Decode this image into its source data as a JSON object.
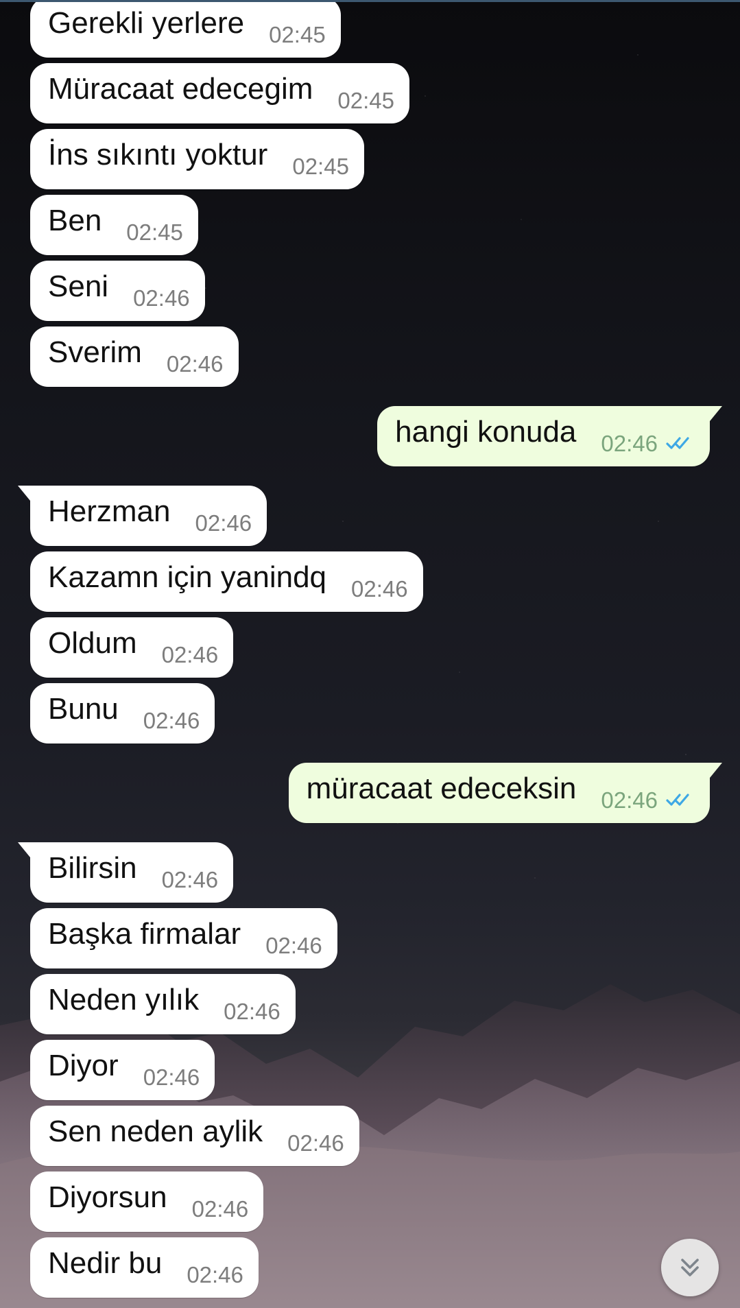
{
  "messages": [
    {
      "text": "Gerekli yerlere",
      "time": "02:45",
      "side": "incoming"
    },
    {
      "text": "Müracaat edecegim",
      "time": "02:45",
      "side": "incoming"
    },
    {
      "text": "İns sıkıntı yoktur",
      "time": "02:45",
      "side": "incoming"
    },
    {
      "text": "Ben",
      "time": "02:45",
      "side": "incoming"
    },
    {
      "text": "Seni",
      "time": "02:46",
      "side": "incoming"
    },
    {
      "text": "Sverim",
      "time": "02:46",
      "side": "incoming"
    },
    {
      "text": "hangi konuda",
      "time": "02:46",
      "side": "outgoing"
    },
    {
      "text": "Herzman",
      "time": "02:46",
      "side": "incoming"
    },
    {
      "text": "Kazamn için yanindq",
      "time": "02:46",
      "side": "incoming"
    },
    {
      "text": "Oldum",
      "time": "02:46",
      "side": "incoming"
    },
    {
      "text": "Bunu",
      "time": "02:46",
      "side": "incoming"
    },
    {
      "text": "müracaat edeceksin",
      "time": "02:46",
      "side": "outgoing"
    },
    {
      "text": "Bilirsin",
      "time": "02:46",
      "side": "incoming"
    },
    {
      "text": "Başka firmalar",
      "time": "02:46",
      "side": "incoming"
    },
    {
      "text": "Neden yılık",
      "time": "02:46",
      "side": "incoming"
    },
    {
      "text": "Diyor",
      "time": "02:46",
      "side": "incoming"
    },
    {
      "text": "Sen neden aylik",
      "time": "02:46",
      "side": "incoming"
    },
    {
      "text": "Diyorsun",
      "time": "02:46",
      "side": "incoming"
    },
    {
      "text": "Nedir bu",
      "time": "02:46",
      "side": "incoming"
    }
  ],
  "icons": {
    "read_receipt": "double-check-icon",
    "scroll_down": "double-chevron-down-icon"
  },
  "colors": {
    "incoming_bubble": "#ffffff",
    "outgoing_bubble": "#effdde",
    "read_check": "#3ea8e5"
  }
}
